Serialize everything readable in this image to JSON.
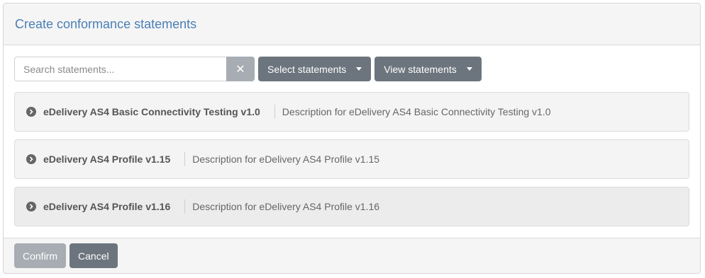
{
  "header": {
    "title": "Create conformance statements"
  },
  "toolbar": {
    "search_placeholder": "Search statements...",
    "search_value": "",
    "clear_label": "✕",
    "select_statements_label": "Select statements",
    "view_statements_label": "View statements"
  },
  "statements": [
    {
      "name": "eDelivery AS4 Basic Connectivity Testing v1.0",
      "description": "Description for eDelivery AS4 Basic Connectivity Testing v1.0"
    },
    {
      "name": "eDelivery AS4 Profile v1.15",
      "description": "Description for eDelivery AS4 Profile v1.15"
    },
    {
      "name": "eDelivery AS4 Profile v1.16",
      "description": "Description for eDelivery AS4 Profile v1.16"
    }
  ],
  "footer": {
    "confirm_label": "Confirm",
    "cancel_label": "Cancel"
  },
  "colors": {
    "title": "#4a7fb5",
    "primary_button": "#6c757d",
    "disabled_button": "#a7adb2"
  }
}
